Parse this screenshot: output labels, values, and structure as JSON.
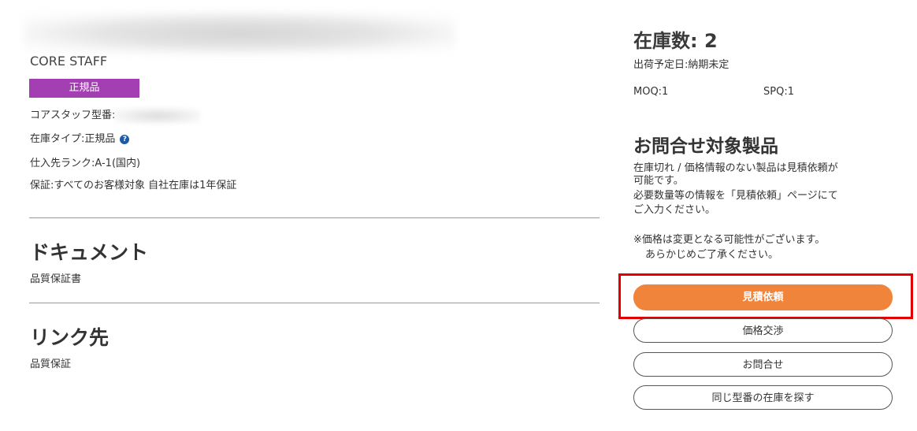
{
  "product": {
    "maker": "CORE STAFF",
    "badge": "正規品",
    "core_part_label": "コアスタッフ型番:",
    "stock_type": "在庫タイプ:正規品",
    "help_icon": "?",
    "supplier_rank": "仕入先ランク:A-1(国内)",
    "warranty": "保証:すべてのお客様対象 自社在庫は1年保証"
  },
  "documents": {
    "heading": "ドキュメント",
    "item": "品質保証書"
  },
  "links": {
    "heading": "リンク先",
    "item": "品質保証"
  },
  "stock": {
    "count_label": "在庫数: 2",
    "ship_date": "出荷予定日:納期未定",
    "moq": "MOQ:1",
    "spq": "SPQ:1"
  },
  "inquiry": {
    "heading": "お問合せ対象製品",
    "line1": "在庫切れ / 価格情報のない製品は見積依頼が",
    "line2": "可能です。",
    "line3": "必要数量等の情報を「見積依頼」ページにて",
    "line4": "ご入力ください。",
    "note1": "※価格は変更となる可能性がございます。",
    "note2": "あらかじめご了承ください。"
  },
  "buttons": {
    "quote": "見積依頼",
    "negotiate": "価格交渉",
    "contact": "お問合せ",
    "same_part": "同じ型番の在庫を探す"
  },
  "colors": {
    "badge": "#a33fb2",
    "primary_button": "#f0843b",
    "highlight": "#e50000",
    "help_icon": "#1a5aa8"
  }
}
